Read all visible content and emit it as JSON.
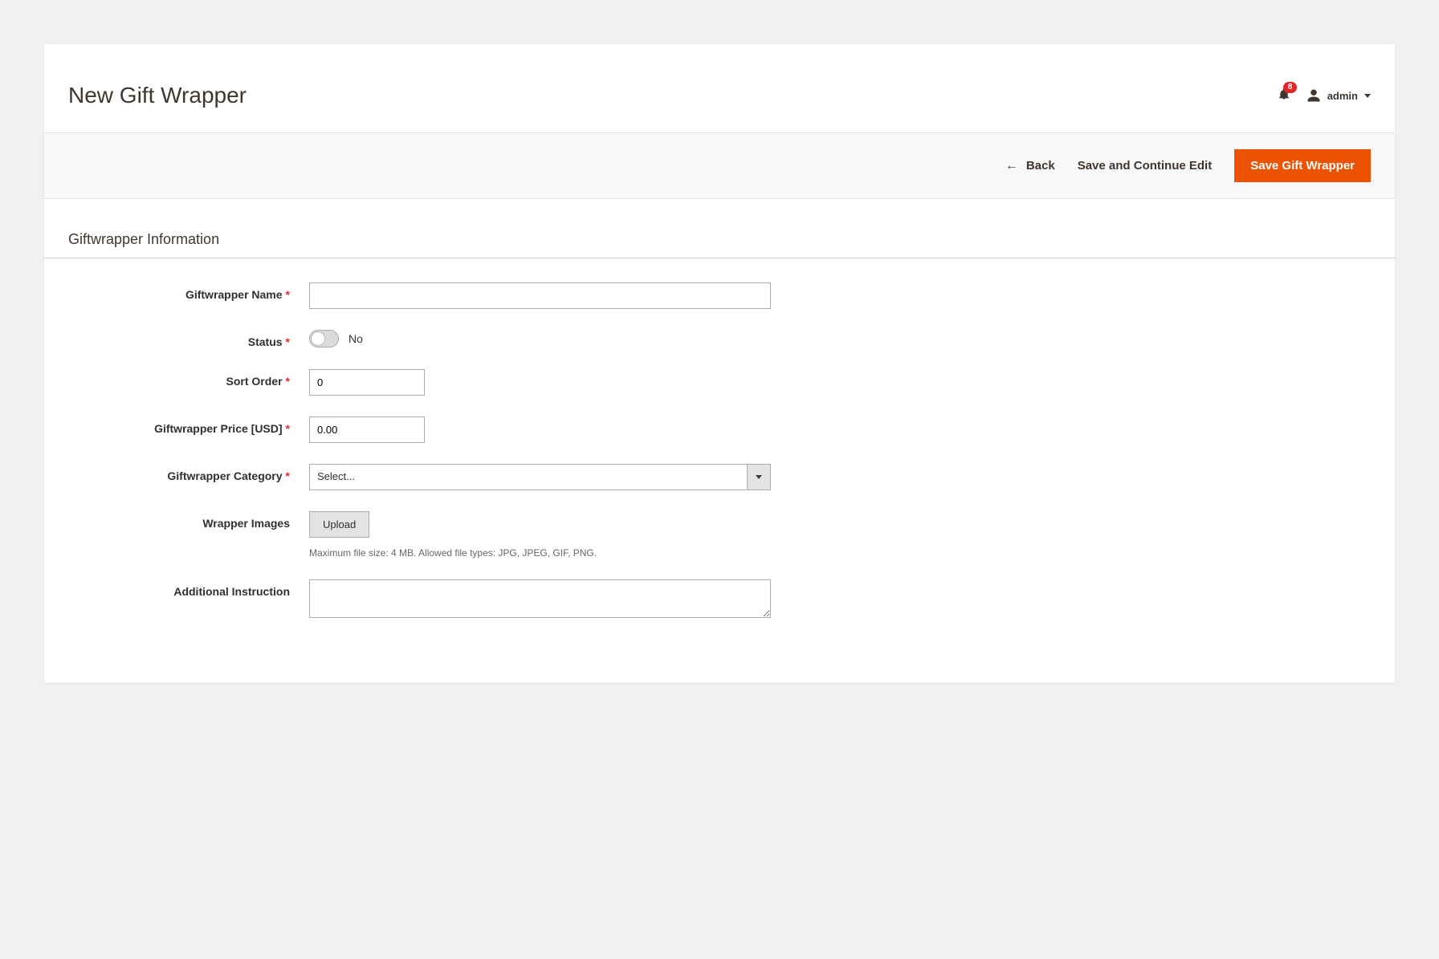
{
  "header": {
    "title": "New Gift Wrapper",
    "notification_count": "8",
    "username": "admin"
  },
  "actions": {
    "back": "Back",
    "save_continue": "Save and Continue Edit",
    "save_primary": "Save Gift Wrapper"
  },
  "section": {
    "title": "Giftwrapper Information"
  },
  "form": {
    "name_label": "Giftwrapper Name",
    "name_value": "",
    "status_label": "Status",
    "status_toggle": "No",
    "sort_label": "Sort Order",
    "sort_value": "0",
    "price_label": "Giftwrapper Price [USD]",
    "price_value": "0.00",
    "category_label": "Giftwrapper Category",
    "category_placeholder": "Select...",
    "images_label": "Wrapper Images",
    "upload_button": "Upload",
    "upload_hint": "Maximum file size: 4 MB. Allowed file types: JPG, JPEG, GIF, PNG.",
    "instruction_label": "Additional Instruction",
    "instruction_value": ""
  }
}
